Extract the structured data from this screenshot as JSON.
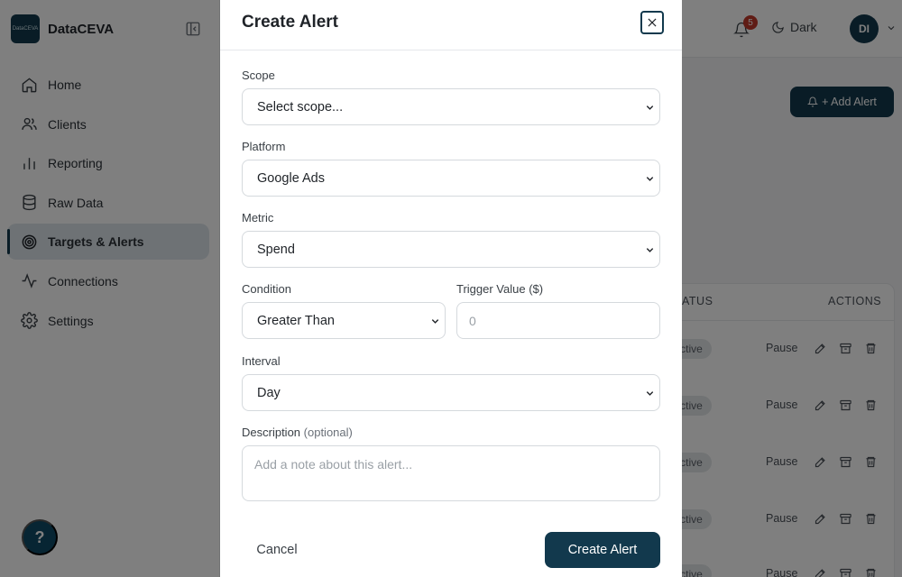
{
  "app": {
    "name": "DataCEVA",
    "logo_text": "DataCEVA"
  },
  "sidebar": {
    "items": [
      {
        "label": "Home",
        "icon": "home-icon"
      },
      {
        "label": "Clients",
        "icon": "users-icon"
      },
      {
        "label": "Reporting",
        "icon": "bar-chart-icon"
      },
      {
        "label": "Raw Data",
        "icon": "database-icon"
      },
      {
        "label": "Targets & Alerts",
        "icon": "target-icon",
        "active": true
      },
      {
        "label": "Connections",
        "icon": "activity-icon"
      },
      {
        "label": "Settings",
        "icon": "gear-icon"
      }
    ],
    "help_label": "?"
  },
  "topbar": {
    "notification_count": "5",
    "theme_label": "Dark",
    "avatar_initials": "DI"
  },
  "page": {
    "add_alert_label": "+ Add Alert",
    "table": {
      "status_header": "STATUS",
      "status_header_visible": "ATUS",
      "actions_header": "ACTIONS",
      "rows": [
        {
          "status": "Active",
          "status_visible": "ctive",
          "action": "Pause"
        },
        {
          "status": "Active",
          "status_visible": "ctive",
          "action": "Pause"
        },
        {
          "status": "Active",
          "status_visible": "ctive",
          "action": "Pause"
        },
        {
          "status": "Active",
          "status_visible": "ctive",
          "action": "Pause"
        },
        {
          "status": "Active",
          "status_visible": "ctive",
          "action": "Pause"
        }
      ]
    }
  },
  "modal": {
    "title": "Create Alert",
    "scope": {
      "label": "Scope",
      "value": "Select scope..."
    },
    "platform": {
      "label": "Platform",
      "value": "Google Ads"
    },
    "metric": {
      "label": "Metric",
      "value": "Spend"
    },
    "condition": {
      "label": "Condition",
      "value": "Greater Than"
    },
    "trigger": {
      "label": "Trigger Value ($)",
      "placeholder": "0"
    },
    "interval": {
      "label": "Interval",
      "value": "Day"
    },
    "description": {
      "label": "Description",
      "optional": "(optional)",
      "placeholder": "Add a note about this alert..."
    },
    "cancel_label": "Cancel",
    "submit_label": "Create Alert"
  },
  "colors": {
    "brand": "#12394d",
    "overlay": "rgba(0,0,0,0.5)",
    "badge": "#c0392b"
  }
}
